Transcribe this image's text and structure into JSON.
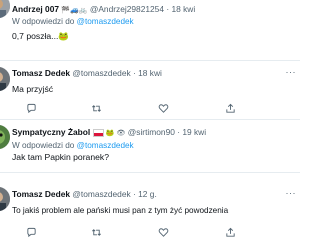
{
  "tweets": [
    {
      "display_name": "Andrzej 007",
      "name_emojis": "🏁🚙🚲",
      "handle": "@Andrzej29821254",
      "separator": "·",
      "time": "18 kwi",
      "reply_prefix": "W odpowiedzi do",
      "reply_handle": "@tomaszdedek",
      "text": "0,7 poszła...🐸"
    },
    {
      "display_name": "Tomasz Dedek",
      "handle": "@tomaszdedek",
      "separator": "·",
      "time": "18 kwi",
      "text": "Ma przyjść"
    },
    {
      "display_name": "Sympatyczny Żabol",
      "name_emojis": "🐸 👁",
      "handle": "@sirtimon90",
      "separator": "·",
      "time": "19 kwi",
      "reply_prefix": "W odpowiedzi do",
      "reply_handle": "@tomaszdedek",
      "text": "Jak tam Papkin poranek?"
    },
    {
      "display_name": "Tomasz Dedek",
      "handle": "@tomaszdedek",
      "separator": "·",
      "time": "12 g.",
      "text": "To jakiś problem ale pański musi pan z tym żyć powodzenia"
    }
  ],
  "more_icon_text": "···",
  "colors": {
    "link_blue": "#1d9bf0",
    "meta_grey": "#536471",
    "divider": "#e6ecf0",
    "text_dark": "#0f1419"
  },
  "icons": [
    "reply-icon",
    "retweet-icon",
    "like-icon",
    "share-icon",
    "more-icon"
  ]
}
